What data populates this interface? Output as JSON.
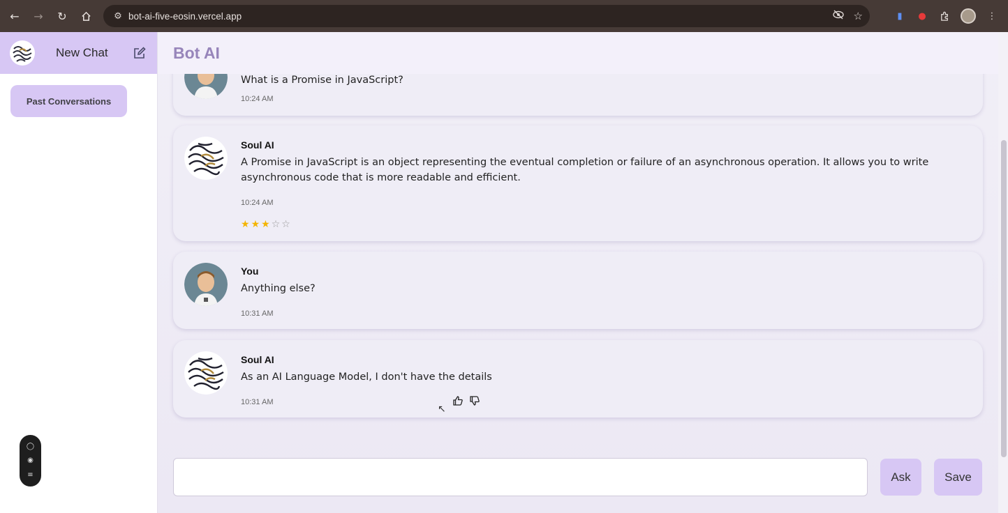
{
  "browser": {
    "url": "bot-ai-five-eosin.vercel.app"
  },
  "sidebar": {
    "new_chat_label": "New Chat",
    "past_conversations_label": "Past Conversations"
  },
  "header": {
    "brand": "Bot AI"
  },
  "messages": [
    {
      "author": "",
      "text": "What is a Promise in JavaScript?",
      "time": "10:24 AM"
    },
    {
      "author": "Soul AI",
      "text": "A Promise in JavaScript is an object representing the eventual completion or failure of an asynchronous operation. It allows you to write asynchronous code that is more readable and efficient.",
      "time": "10:24 AM",
      "rating": 3,
      "rating_max": 5
    },
    {
      "author": "You",
      "text": "Anything else?",
      "time": "10:31 AM"
    },
    {
      "author": "Soul AI",
      "text": "As an AI Language Model, I don't have the details",
      "time": "10:31 AM"
    }
  ],
  "composer": {
    "value": "",
    "ask_label": "Ask",
    "save_label": "Save"
  },
  "colors": {
    "accent": "#d7c7f4",
    "brand_text": "#9785ba",
    "chrome": "#463a36",
    "star": "#f4b400"
  },
  "icons": [
    "back-icon",
    "forward-icon",
    "reload-icon",
    "home-icon",
    "site-settings-icon",
    "eye-off-icon",
    "bookmark-star-icon",
    "extensions-icon",
    "menu-icon",
    "edit-icon",
    "thumbs-up-icon",
    "thumbs-down-icon"
  ]
}
